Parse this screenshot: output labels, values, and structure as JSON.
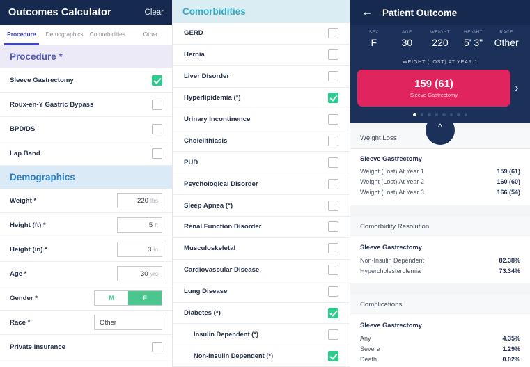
{
  "left": {
    "header": {
      "title": "Outcomes Calculator",
      "clear_label": "Clear"
    },
    "tabs": [
      {
        "label": "Procedure",
        "active": true
      },
      {
        "label": "Demographics",
        "active": false
      },
      {
        "label": "Comorbidities",
        "active": false
      },
      {
        "label": "Other",
        "active": false
      }
    ],
    "procedure": {
      "section_title": "Procedure *",
      "items": [
        {
          "label": "Sleeve Gastrectomy",
          "checked": true
        },
        {
          "label": "Roux-en-Y Gastric Bypass",
          "checked": false
        },
        {
          "label": "BPD/DS",
          "checked": false
        },
        {
          "label": "Lap Band",
          "checked": false
        }
      ]
    },
    "demographics": {
      "section_title": "Demographics",
      "weight": {
        "label": "Weight *",
        "value": "220",
        "unit": "lbs"
      },
      "height_ft": {
        "label": "Height (ft) *",
        "value": "5",
        "unit": "ft"
      },
      "height_in": {
        "label": "Height (in) *",
        "value": "3",
        "unit": "in"
      },
      "age": {
        "label": "Age *",
        "value": "30",
        "unit": "yrs"
      },
      "gender": {
        "label": "Gender *",
        "option_m": "M",
        "option_f": "F",
        "selected": "F"
      },
      "race": {
        "label": "Race *",
        "value": "Other"
      },
      "private_insurance": {
        "label": "Private Insurance",
        "checked": false
      }
    }
  },
  "comorbidities": {
    "section_title": "Comorbidities",
    "items": [
      {
        "label": "GERD",
        "checked": false,
        "indent": false
      },
      {
        "label": "Hernia",
        "checked": false,
        "indent": false
      },
      {
        "label": "Liver Disorder",
        "checked": false,
        "indent": false
      },
      {
        "label": "Hyperlipidemia (*)",
        "checked": true,
        "indent": false
      },
      {
        "label": "Urinary Incontinence",
        "checked": false,
        "indent": false
      },
      {
        "label": "Cholelithiasis",
        "checked": false,
        "indent": false
      },
      {
        "label": "PUD",
        "checked": false,
        "indent": false
      },
      {
        "label": "Psychological Disorder",
        "checked": false,
        "indent": false
      },
      {
        "label": "Sleep Apnea (*)",
        "checked": false,
        "indent": false
      },
      {
        "label": "Renal Function Disorder",
        "checked": false,
        "indent": false
      },
      {
        "label": "Musculoskeletal",
        "checked": false,
        "indent": false
      },
      {
        "label": "Cardiovascular Disease",
        "checked": false,
        "indent": false
      },
      {
        "label": "Lung Disease",
        "checked": false,
        "indent": false
      },
      {
        "label": "Diabetes (*)",
        "checked": true,
        "indent": false
      },
      {
        "label": "Insulin Dependent (*)",
        "checked": false,
        "indent": true
      },
      {
        "label": "Non-Insulin Dependent (*)",
        "checked": true,
        "indent": true
      }
    ]
  },
  "right": {
    "header": {
      "title": "Patient Outcome",
      "back_icon": "arrow-left-icon"
    },
    "stats": [
      {
        "key": "SEX",
        "value": "F"
      },
      {
        "key": "AGE",
        "value": "30"
      },
      {
        "key": "WEIGHT",
        "value": "220"
      },
      {
        "key": "HEIGHT",
        "value": "5' 3\""
      },
      {
        "key": "RACE",
        "value": "Other"
      }
    ],
    "carousel": {
      "title": "WEIGHT (LOST) AT YEAR 1",
      "card_value": "159 (61)",
      "card_subtitle": "Sleeve Gastrectomy",
      "next_icon": "chevron-right-icon",
      "dots_total": 8,
      "dots_active_index": 0,
      "collapse_icon": "chevron-up-icon",
      "accent_color": "#e0245e"
    },
    "panels": [
      {
        "title": "Weight Loss",
        "subtitle": "Sleeve Gastrectomy",
        "rows": [
          {
            "key": "Weight (Lost) At Year 1",
            "value": "159 (61)"
          },
          {
            "key": "Weight (Lost) At Year 2",
            "value": "160 (60)"
          },
          {
            "key": "Weight (Lost) At Year 3",
            "value": "166 (54)"
          }
        ]
      },
      {
        "title": "Comorbidity Resolution",
        "subtitle": "Sleeve Gastrectomy",
        "rows": [
          {
            "key": "Non-Insulin Dependent",
            "value": "82.38%"
          },
          {
            "key": "Hypercholesterolemia",
            "value": "73.34%"
          }
        ]
      },
      {
        "title": "Complications",
        "subtitle": "Sleeve Gastrectomy",
        "rows": [
          {
            "key": "Any",
            "value": "4.35%"
          },
          {
            "key": "Severe",
            "value": "1.29%"
          },
          {
            "key": "Death",
            "value": "0.02%"
          }
        ]
      }
    ]
  }
}
